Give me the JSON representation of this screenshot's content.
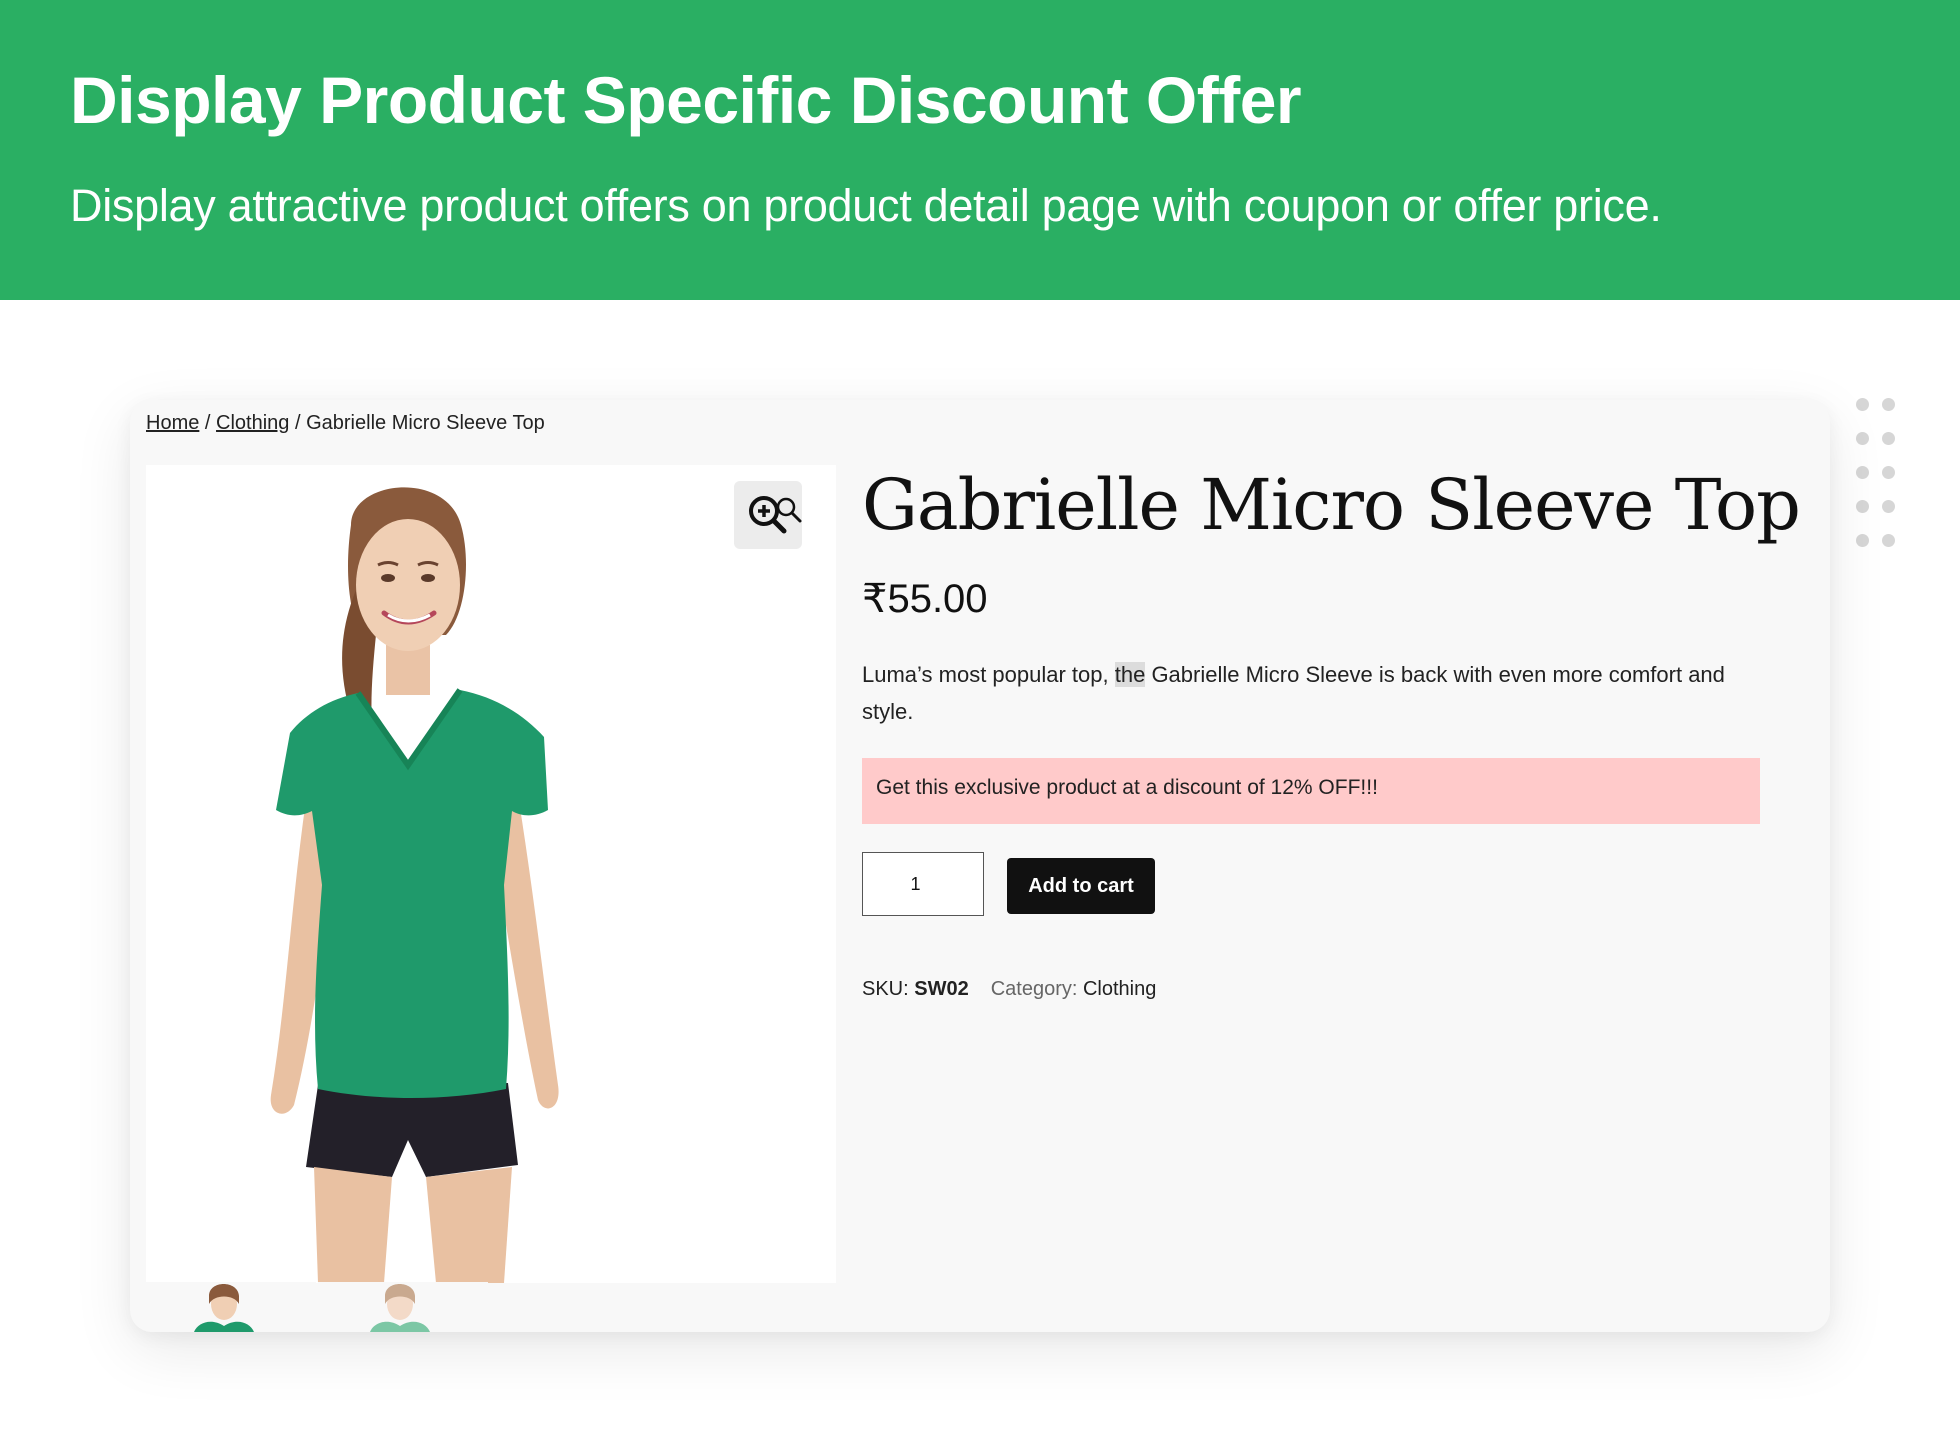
{
  "banner": {
    "title": "Display Product Specific Discount Offer",
    "subtitle": "Display attractive product offers on product detail page with coupon or offer price."
  },
  "breadcrumb": {
    "home": "Home",
    "separator": " / ",
    "category": "Clothing",
    "current": "Gabrielle Micro Sleeve Top"
  },
  "product": {
    "title": "Gabrielle Micro Sleeve Top",
    "price": "₹55.00",
    "description_before": "Luma’s most popular top, ",
    "description_highlight": "the",
    "description_after": " Gabrielle Micro Sleeve is back with even more comfort and style.",
    "offer_text": "Get this exclusive product at a discount of 12% OFF!!!",
    "quantity": "1",
    "add_to_cart_label": "Add to cart",
    "sku_label": "SKU: ",
    "sku_value": "SW02",
    "category_label": "Category: ",
    "category_value": "Clothing"
  },
  "colors": {
    "banner": "#2aaf63",
    "offer_background": "#ffcaca",
    "button": "#111111",
    "tshirt": "#1f9a6b"
  },
  "icons": [
    "zoom-in-icon",
    "search-icon"
  ]
}
